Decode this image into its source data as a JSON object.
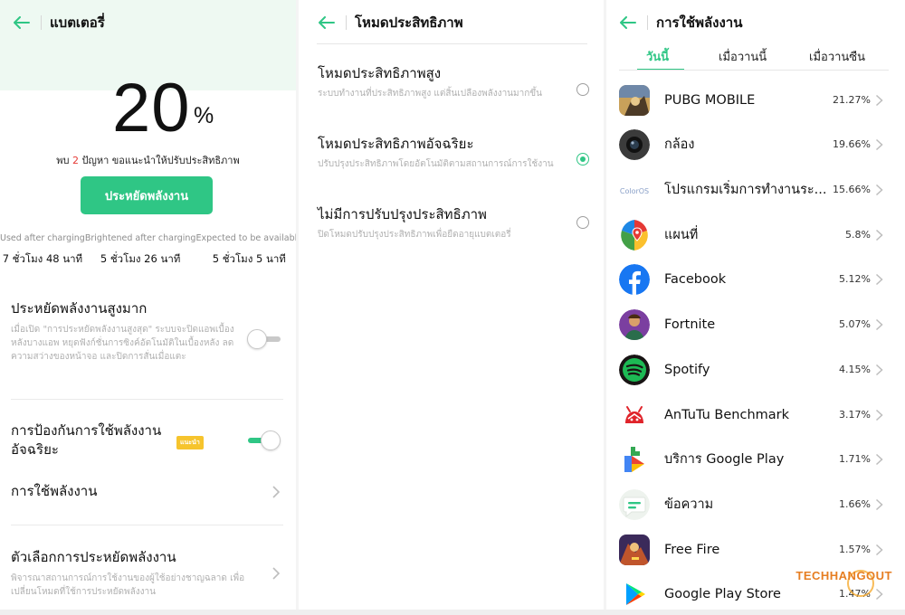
{
  "battery": {
    "title": "แบตเตอรี่",
    "level": "20",
    "unit": "%",
    "tip_prefix": "พบ",
    "tip_count": "2",
    "tip_suffix": "ปัญหา ขอแนะนำให้ปรับประสิทธิภาพ",
    "save_button": "ประหยัดพลังงาน",
    "stats": [
      {
        "label": "Used after charging",
        "value": "7 ชั่วโมง 48 นาที"
      },
      {
        "label": "Brightened after charging",
        "value": "5 ชั่วโมง 26 นาที"
      },
      {
        "label": "Expected to be available",
        "value": "5 ชั่วโมง 5 นาที"
      }
    ],
    "super_saver": {
      "title": "ประหยัดพลังงานสูงมาก",
      "desc": "เมื่อเปิด \"การประหยัดพลังงานสูงสุด\" ระบบจะปิดแอพเบื้องหลังบางแอพ หยุดฟังก์ชั่นการซิงค์อัตโนมัติในเบื้องหลัง ลดความสว่างของหน้าจอ และปิดการสั่นเมื่อแตะ",
      "enabled": false
    },
    "smart_protect": {
      "title": "การป้องกันการใช้พลังงานอัจฉริยะ",
      "badge": "แนะนำ",
      "enabled": true
    },
    "power_usage_label": "การใช้พลังงาน",
    "saving_options": {
      "title": "ตัวเลือกการประหยัดพลังงาน",
      "desc": "พิจารณาสถานการณ์การใช้งานของผู้ใช้อย่างชาญฉลาด เพื่อเปลี่ยนโหมดที่ใช้การประหยัดพลังงาน"
    }
  },
  "performance": {
    "title": "โหมดประสิทธิภาพ",
    "modes": [
      {
        "title": "โหมดประสิทธิภาพสูง",
        "desc": "ระบบทำงานที่ประสิทธิภาพสูง แต่สิ้นเปลืองพลังงานมากขึ้น",
        "selected": false
      },
      {
        "title": "โหมดประสิทธิภาพอัจฉริยะ",
        "desc": "ปรับปรุงประสิทธิภาพโดยอัตโนมัติตามสถานการณ์การใช้งาน",
        "selected": true
      },
      {
        "title": "ไม่มีการปรับปรุงประสิทธิภาพ",
        "desc": "ปิดโหมดปรับปรุงประสิทธิภาพเพื่อยืดอายุแบตเตอรี่",
        "selected": false
      }
    ]
  },
  "usage": {
    "title": "การใช้พลังงาน",
    "tabs": [
      "วันนี้",
      "เมื่อวานนี้",
      "เมื่อวานซืน"
    ],
    "active_tab": 0,
    "apps": [
      {
        "name": "PUBG MOBILE",
        "percent": "21.27%",
        "icon": "pubg-icon"
      },
      {
        "name": "กล้อง",
        "percent": "19.66%",
        "icon": "camera-icon"
      },
      {
        "name": "โปรแกรมเริ่มการทำงานระ...",
        "percent": "15.66%",
        "icon": "coloros-icon"
      },
      {
        "name": "แผนที่",
        "percent": "5.8%",
        "icon": "maps-icon"
      },
      {
        "name": "Facebook",
        "percent": "5.12%",
        "icon": "facebook-icon"
      },
      {
        "name": "Fortnite",
        "percent": "5.07%",
        "icon": "fortnite-icon"
      },
      {
        "name": "Spotify",
        "percent": "4.15%",
        "icon": "spotify-icon"
      },
      {
        "name": "AnTuTu Benchmark",
        "percent": "3.17%",
        "icon": "antutu-icon"
      },
      {
        "name": "บริการ Google Play",
        "percent": "1.71%",
        "icon": "play-services-icon"
      },
      {
        "name": "ข้อความ",
        "percent": "1.66%",
        "icon": "messages-icon"
      },
      {
        "name": "Free Fire",
        "percent": "1.57%",
        "icon": "freefire-icon"
      },
      {
        "name": "Google Play Store",
        "percent": "1.47%",
        "icon": "play-store-icon"
      }
    ]
  },
  "watermark": {
    "tech": "TECH",
    "hangout": "HANGOUT"
  },
  "colors": {
    "accent": "#2fc685",
    "warning": "#e53935",
    "badge": "#f6c42d"
  }
}
